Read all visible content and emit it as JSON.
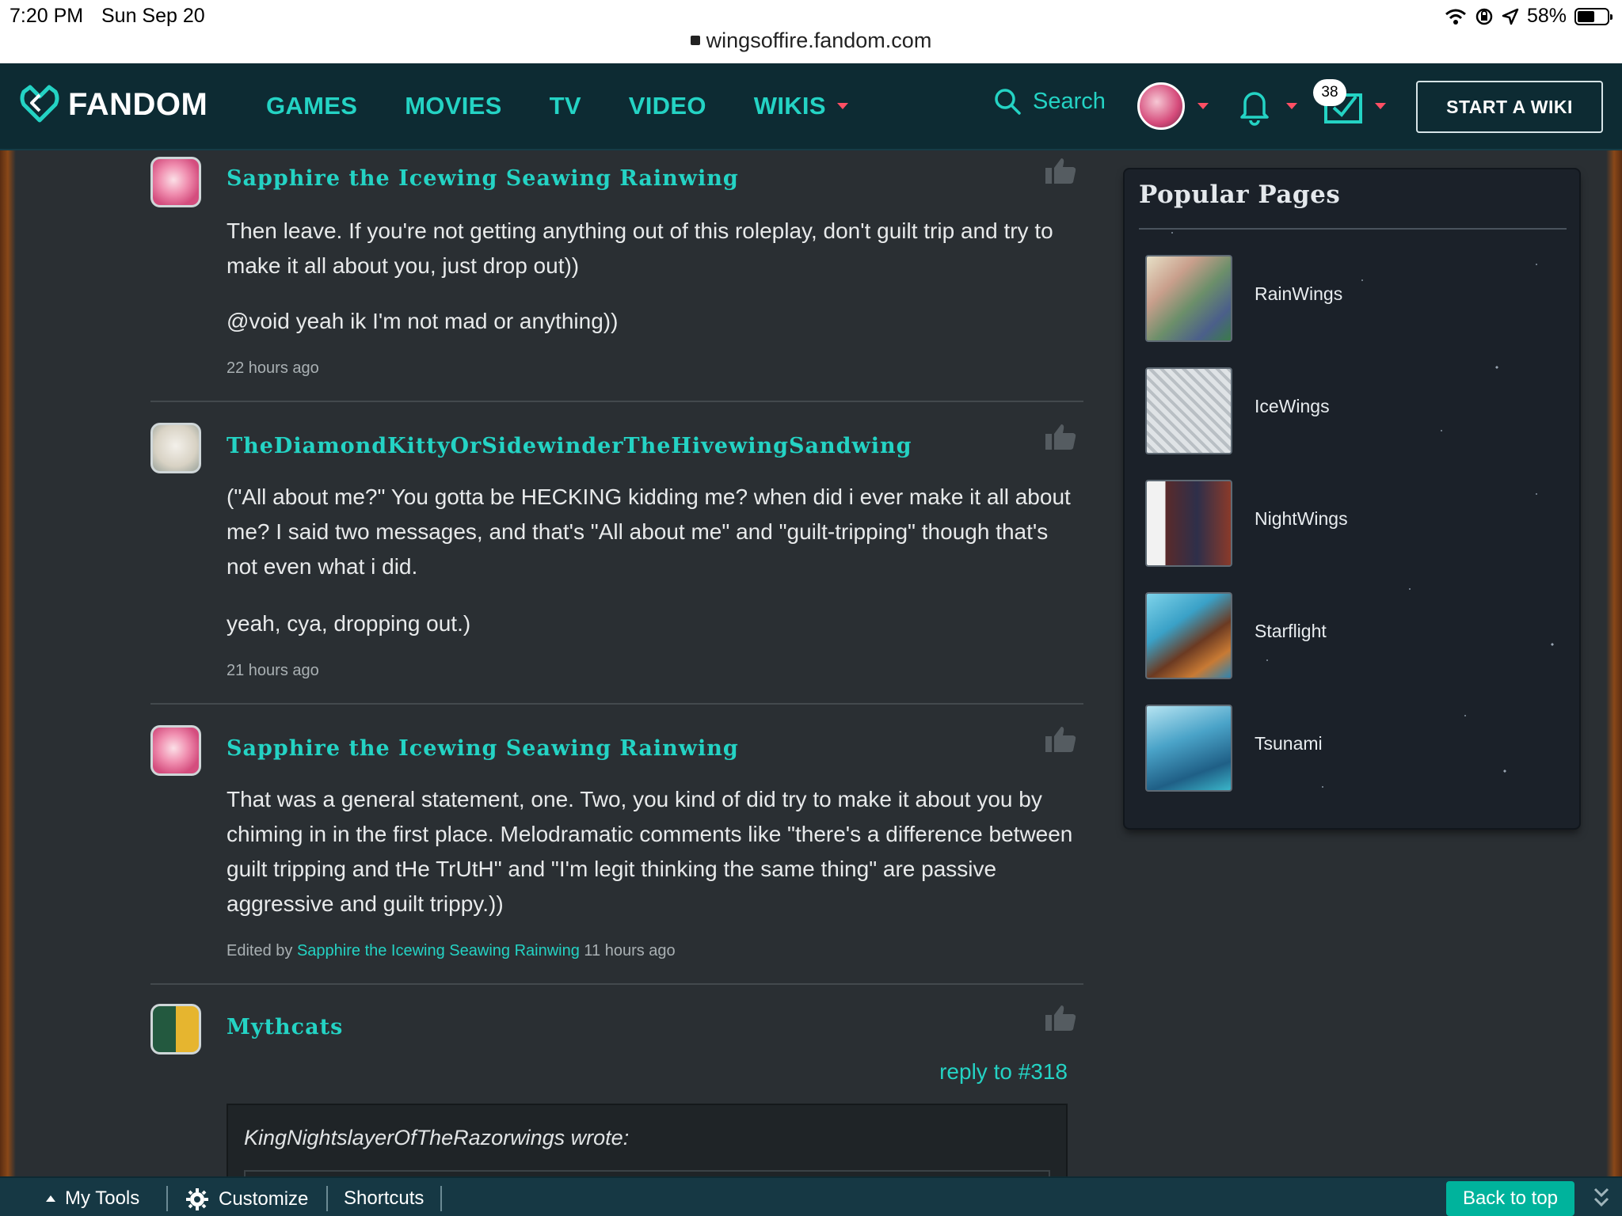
{
  "status_bar": {
    "time": "7:20 PM",
    "date": "Sun Sep 20",
    "battery": "58%",
    "battery_level": 0.58,
    "url": "wingsoffire.fandom.com"
  },
  "nav": {
    "logo": "FANDOM",
    "links": [
      "GAMES",
      "MOVIES",
      "TV",
      "VIDEO",
      "WIKIS"
    ],
    "search_label": "Search",
    "mail_badge": "38",
    "start_wiki": "START A WIKI",
    "accent": "#24d3c4",
    "caret_color": "#ff4f64"
  },
  "comments": [
    {
      "author": "Sapphire the Icewing Seawing Rainwing",
      "avatar_icon": "pink-avatar",
      "paragraphs": [
        "Then leave. If you're not getting anything out of this roleplay, don't guilt trip and try to make it all about you, just drop out))",
        "@void yeah ik I'm not mad or anything))"
      ],
      "time": "22 hours ago"
    },
    {
      "author": "TheDiamondKittyOrSidewinderTheHivewingSandwing",
      "avatar_icon": "kitty-avatar",
      "paragraphs": [
        "(\"All about me?\" You gotta be HECKING kidding me? when did i ever make it all about me? I said two messages, and that's \"All about me\" and \"guilt-tripping\" though that's not even what i did.",
        "yeah, cya, dropping out.)"
      ],
      "time": "21 hours ago"
    },
    {
      "author": "Sapphire the Icewing Seawing Rainwing",
      "avatar_icon": "pink-avatar",
      "paragraphs": [
        "That was a general statement, one. Two, you kind of did try to make it about you by chiming in in the first place. Melodramatic comments like \"there's a difference between guilt tripping and tHe TrUtH\" and \"I'm legit thinking the same thing\" are passive aggressive and guilt trippy.))"
      ],
      "edited_prefix": "Edited by",
      "edited_by": "Sapphire the Icewing Seawing Rainwing",
      "time": "11 hours ago"
    },
    {
      "author": "Mythcats",
      "avatar_icon": "mythcats-avatar",
      "reply_to": "reply to #318",
      "quote": "KingNightslayerOfTheRazorwings wrote:"
    }
  ],
  "sidebar": {
    "title": "Popular Pages",
    "items": [
      {
        "label": "RainWings"
      },
      {
        "label": "IceWings"
      },
      {
        "label": "NightWings"
      },
      {
        "label": "Starflight"
      },
      {
        "label": "Tsunami"
      }
    ]
  },
  "toolbar": {
    "my_tools": "My Tools",
    "customize": "Customize",
    "shortcuts": "Shortcuts",
    "back_to_top": "Back to top"
  }
}
